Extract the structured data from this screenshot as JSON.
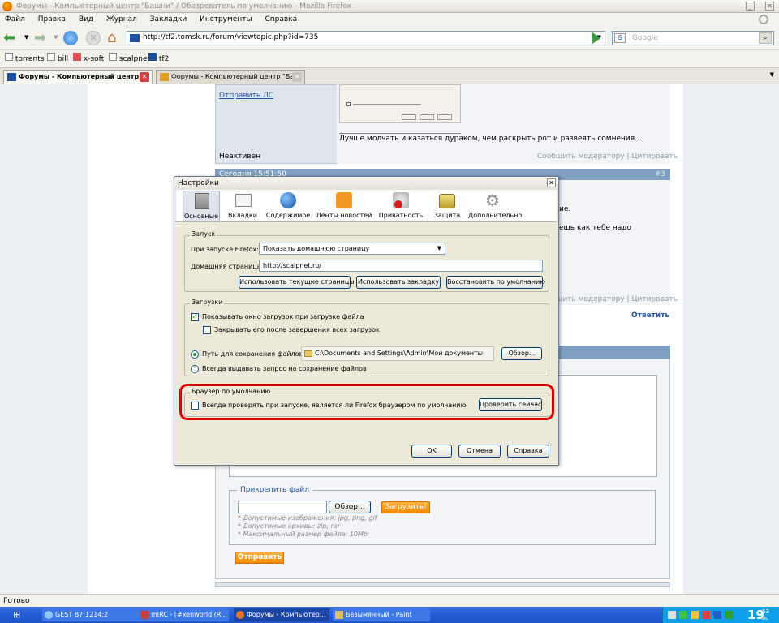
{
  "window": {
    "title": "Форумы - Компьютерный центр \"Башни\" / Обозреватель по умолчанию - Mozilla Firefox"
  },
  "menu": [
    "Файл",
    "Правка",
    "Вид",
    "Журнал",
    "Закладки",
    "Инструменты",
    "Справка"
  ],
  "nav": {
    "url": "http://tf2.tomsk.ru/forum/viewtopic.php?id=735",
    "search_placeholder": "Google"
  },
  "bookmarks": [
    "torrents",
    "bill",
    "x-soft",
    "scalpnet",
    "tf2"
  ],
  "tabs": [
    {
      "label": "Форумы - Компьютерный центр ...",
      "active": true
    },
    {
      "label": "Форумы - Компьютерный центр \"Ба...",
      "active": false
    }
  ],
  "forum": {
    "send_pm": "Отправить ЛС",
    "signature": "Лучше молчать и казаться дураком, чем раскрыть рот и развеять сомнения...",
    "status": "Неактивен",
    "report": "Сообщить модератору",
    "separator": "|",
    "quote": "Цитировать",
    "post_time": "Сегодня 15:51:50",
    "post_num": "#3",
    "text_1": "ие.",
    "text_2": "ешь как тебе надо",
    "report2": "Сообщить модератору",
    "quote2": "Цитировать",
    "reply": "Ответить",
    "attach_title": "Прикрепить файл",
    "browse": "Обзор...",
    "upload": "Загрузить!",
    "hint1": "* Допустимые изображения: jpg, png, gif",
    "hint2": "* Допустимые архивы: zip, rar",
    "hint3": "* Максимальный размер файла: 10Mb",
    "send": "Отправить"
  },
  "dialog": {
    "title": "Настройки",
    "toolbar": [
      "Основные",
      "Вкладки",
      "Содержимое",
      "Ленты новостей",
      "Приватность",
      "Защита",
      "Дополнительно"
    ],
    "startup": {
      "legend": "Запуск",
      "on_start_label": "При запуске Firefox:",
      "on_start_value": "Показать домашнюю страницу",
      "home_label": "Домашняя страница:",
      "home_value": "http://scalpnet.ru/",
      "btn_current": "Использовать текущие страницы",
      "btn_bookmark": "Использовать закладку",
      "btn_restore": "Восстановить по умолчанию"
    },
    "downloads": {
      "legend": "Загрузки",
      "show_window": "Показывать окно загрузок при загрузке файла",
      "close_after": "Закрывать его после завершения всех загрузок",
      "save_path_label": "Путь для сохранения файлов",
      "save_path_value": "C:\\Documents and Settings\\Admin\\Мои документы",
      "browse": "Обзор...",
      "always_ask": "Всегда выдавать запрос на сохранение файлов"
    },
    "default_browser": {
      "legend": "Браузер по умолчанию",
      "check_label": "Всегда проверять при запуске, является ли Firefox браузером по умолчанию",
      "check_now": "Проверить сейчас"
    },
    "ok": "OK",
    "cancel": "Отмена",
    "help": "Справка"
  },
  "status": "Готово",
  "taskbar": {
    "tasks": [
      "GEST B7:1214:2",
      "mIRC - [#xenworld (R...",
      "Форумы - Компьютер...",
      "Безымянный - Paint"
    ],
    "clock": "19",
    "clock_small": "53 вс"
  },
  "colors": {
    "accent": "#245edb",
    "forum_header": "#7fa0c0",
    "highlight": "#e00000"
  }
}
